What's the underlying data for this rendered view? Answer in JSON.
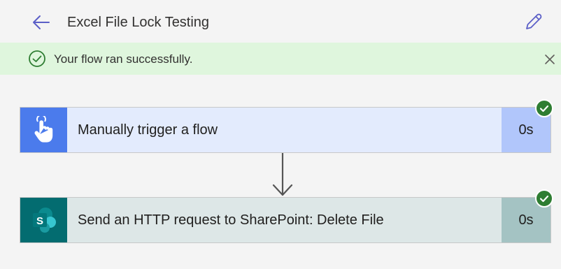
{
  "header": {
    "title": "Excel File Lock Testing",
    "back_icon": "back-arrow-icon",
    "edit_icon": "pencil-icon"
  },
  "banner": {
    "message": "Your flow ran successfully.",
    "status_icon": "check-circle-icon",
    "close_icon": "close-icon"
  },
  "steps": [
    {
      "label": "Manually trigger a flow",
      "duration": "0s",
      "icon": "hand-touch-icon",
      "status": "succeeded",
      "colors": {
        "icon_bg": "#4b7bec",
        "body_bg": "#e3ebfd",
        "duration_bg": "#b1c6fb"
      }
    },
    {
      "label": "Send an HTTP request to SharePoint: Delete File",
      "duration": "0s",
      "icon": "sharepoint-icon",
      "status": "succeeded",
      "colors": {
        "icon_bg": "#036c70",
        "body_bg": "#dde7e7",
        "duration_bg": "#a4c3c3"
      }
    }
  ],
  "colors": {
    "accent": "#5b5fc7",
    "success": "#2e7d32",
    "banner_bg": "#dff6dd"
  }
}
